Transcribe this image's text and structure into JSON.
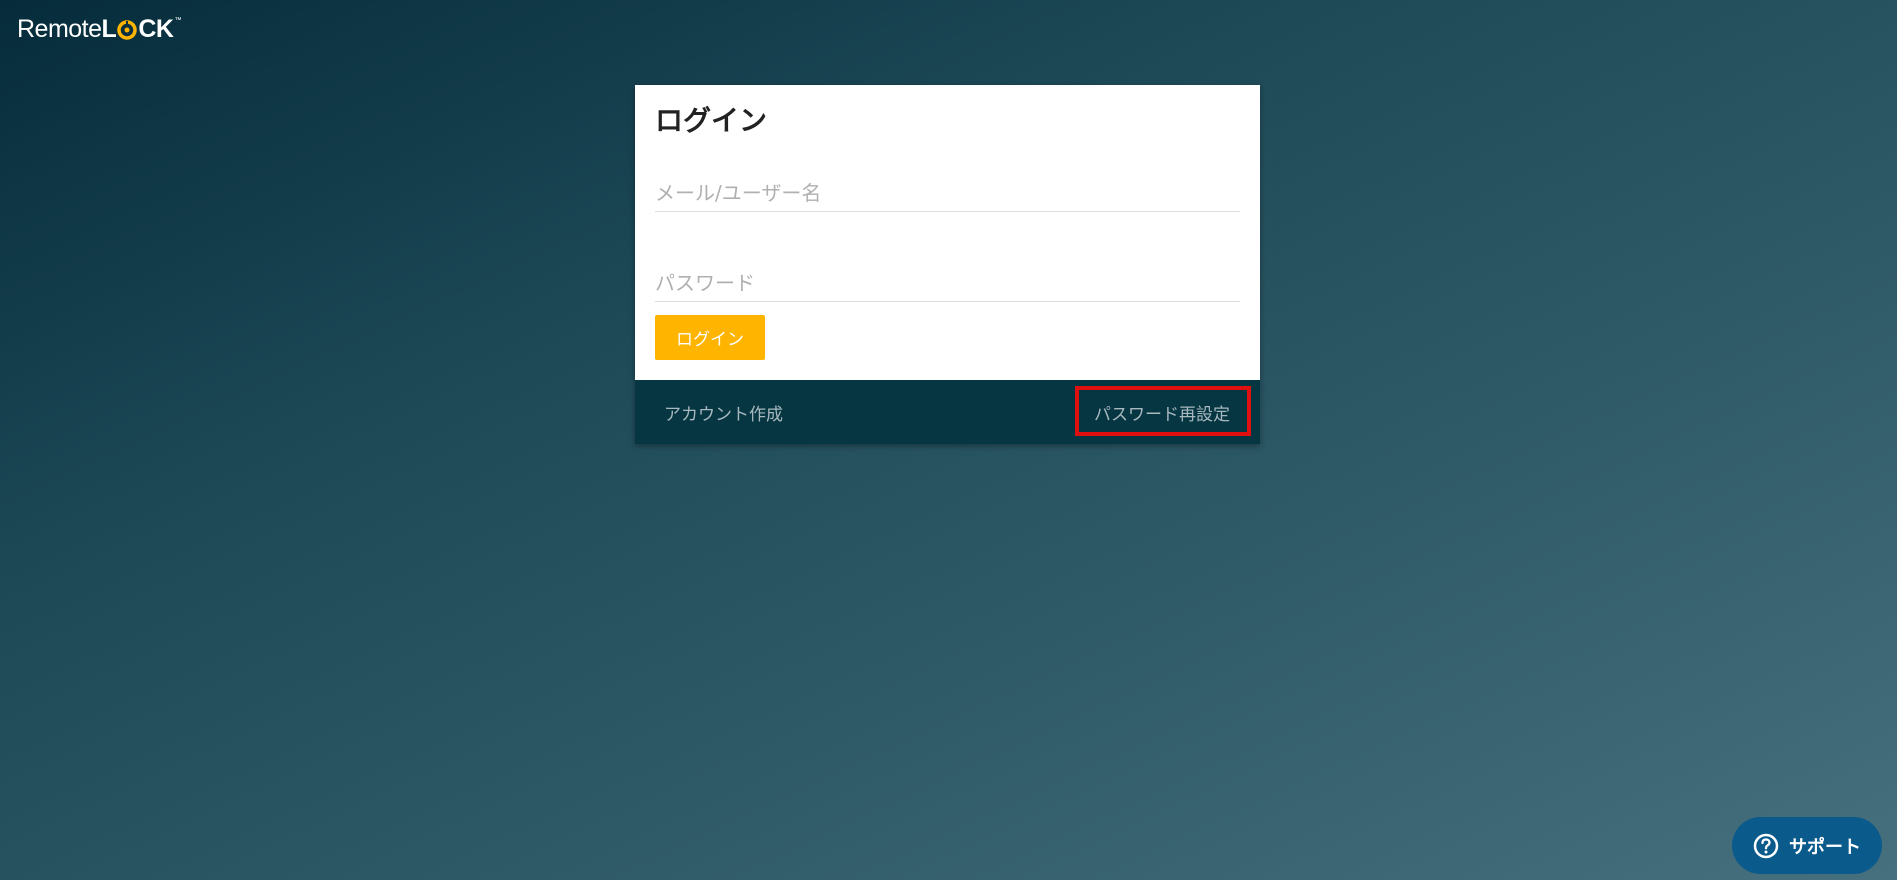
{
  "logo": {
    "remote": "Remote",
    "lock_l": "L",
    "lock_ck": "CK",
    "tm": "™"
  },
  "login_form": {
    "title": "ログイン",
    "email_placeholder": "メール/ユーザー名",
    "password_placeholder": "パスワード",
    "login_label": "ログイン"
  },
  "footer": {
    "create_account": "アカウント作成",
    "reset_password": "パスワード再設定"
  },
  "support": {
    "label": "サポート"
  },
  "colors": {
    "accent": "#ffb400",
    "footer_bg": "#063642",
    "highlight": "#e01010",
    "support_bg": "#0b5a8c"
  }
}
